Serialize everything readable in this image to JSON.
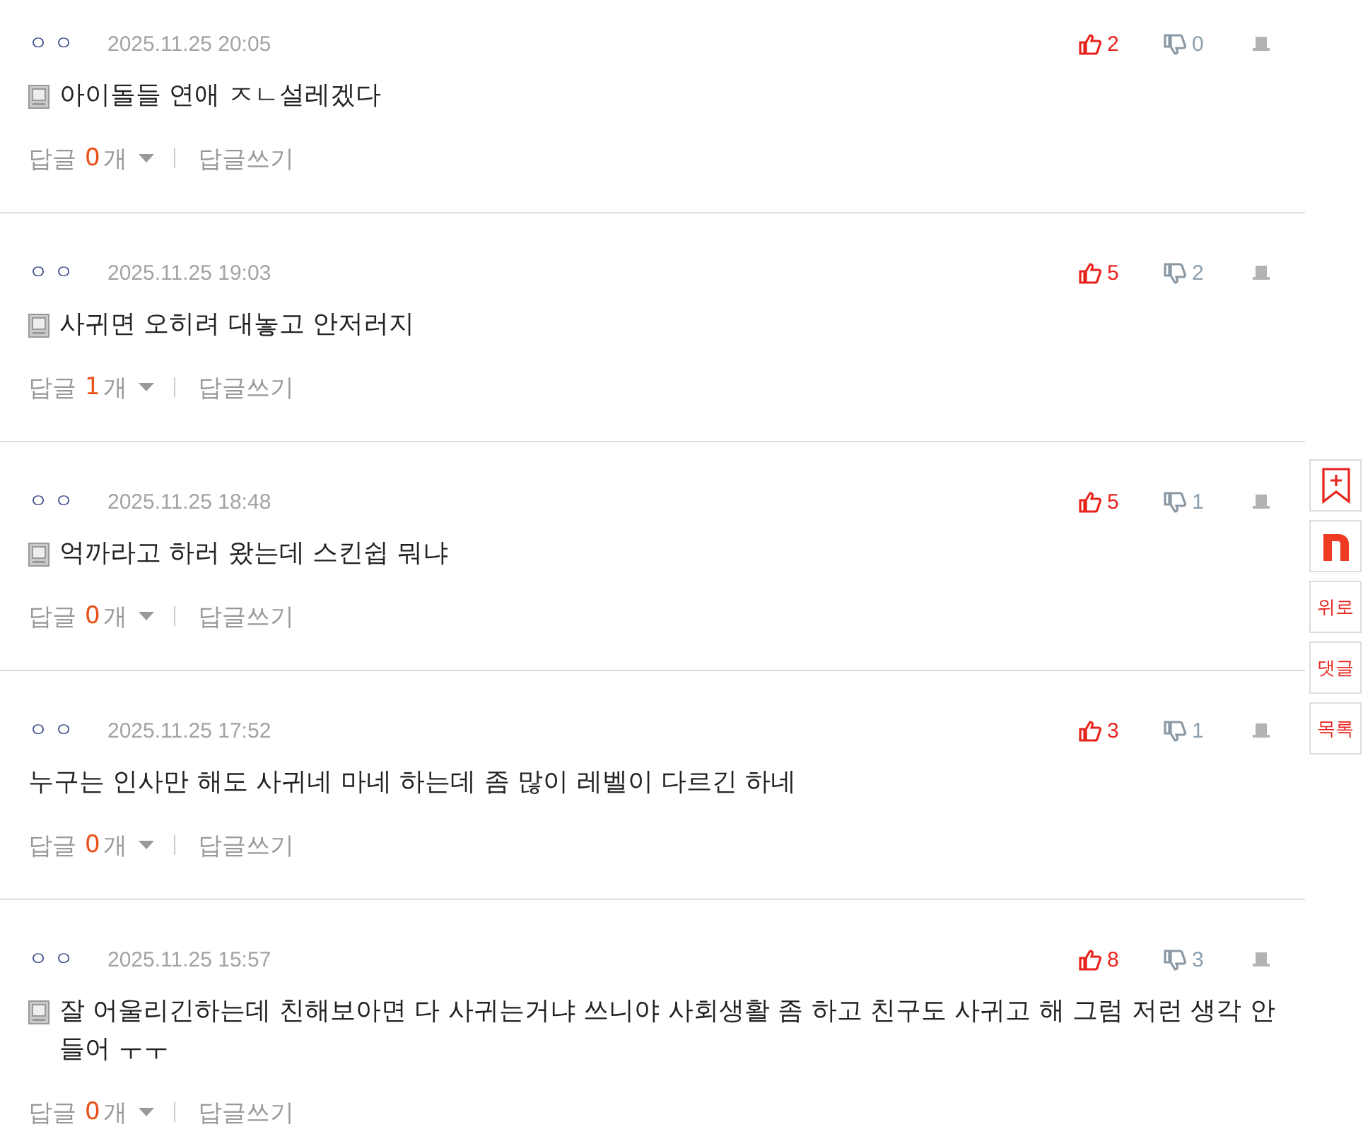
{
  "comments": [
    {
      "author": "ㅇㅇ",
      "date": "2025.11.25 20:05",
      "likes": "2",
      "dislikes": "0",
      "mobile": true,
      "text": "아이돌들 연애 ㅈㄴ설레겠다",
      "reply_label": "답글",
      "reply_count": "0",
      "reply_unit": "개",
      "write_label": "답글쓰기"
    },
    {
      "author": "ㅇㅇ",
      "date": "2025.11.25 19:03",
      "likes": "5",
      "dislikes": "2",
      "mobile": true,
      "text": "사귀면 오히려 대놓고 안저러지",
      "reply_label": "답글",
      "reply_count": "1",
      "reply_unit": "개",
      "write_label": "답글쓰기"
    },
    {
      "author": "ㅇㅇ",
      "date": "2025.11.25 18:48",
      "likes": "5",
      "dislikes": "1",
      "mobile": true,
      "text": "억까라고 하러 왔는데 스킨쉽 뭐냐",
      "reply_label": "답글",
      "reply_count": "0",
      "reply_unit": "개",
      "write_label": "답글쓰기"
    },
    {
      "author": "ㅇㅇ",
      "date": "2025.11.25 17:52",
      "likes": "3",
      "dislikes": "1",
      "mobile": false,
      "text": "누구는 인사만 해도 사귀네 마네 하는데 좀 많이 레벨이 다르긴 하네",
      "reply_label": "답글",
      "reply_count": "0",
      "reply_unit": "개",
      "write_label": "답글쓰기"
    },
    {
      "author": "ㅇㅇ",
      "date": "2025.11.25 15:57",
      "likes": "8",
      "dislikes": "3",
      "mobile": true,
      "text": "잘 어울리긴하는데 친해보아면 다 사귀는거냐 쓰니야 사회생활 좀 하고 친구도 사귀고 해 그럼 저런 생각 안들어 ㅜㅜ",
      "reply_label": "답글",
      "reply_count": "0",
      "reply_unit": "개",
      "write_label": "답글쓰기"
    }
  ],
  "side_buttons": [
    {
      "kind": "bookmark"
    },
    {
      "kind": "logo"
    },
    {
      "kind": "text",
      "label": "위로"
    },
    {
      "kind": "text",
      "label": "댓글"
    },
    {
      "kind": "text",
      "label": "목록"
    }
  ]
}
